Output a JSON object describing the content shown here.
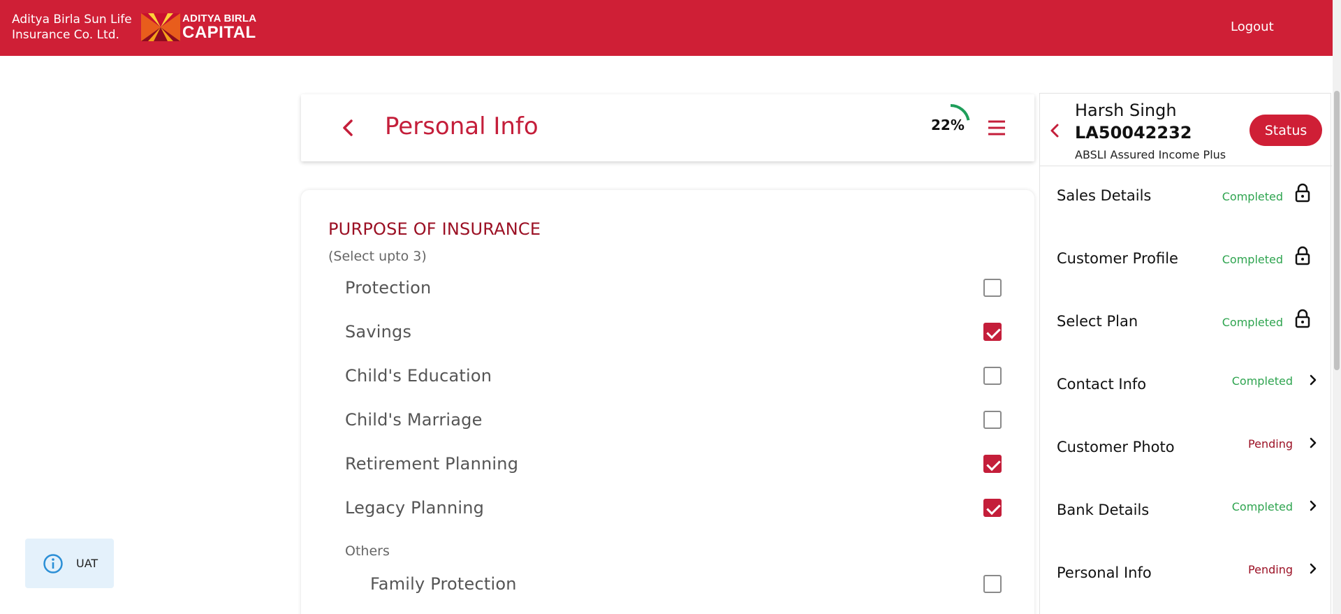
{
  "header": {
    "brand_line1": "Aditya Birla Sun Life",
    "brand_line2": "Insurance Co. Ltd.",
    "logo_line1": "ADITYA BIRLA",
    "logo_line2": "CAPITAL",
    "logout_label": "Logout",
    "bg_color": "#cf1f36"
  },
  "page": {
    "title": "Personal Info",
    "progress_text": "22%",
    "progress_value": 0.22
  },
  "purpose": {
    "title": "PURPOSE OF INSURANCE",
    "subtitle": "(Select upto 3)",
    "options": [
      {
        "label": "Protection",
        "checked": false
      },
      {
        "label": "Savings",
        "checked": true
      },
      {
        "label": "Child's Education",
        "checked": false
      },
      {
        "label": "Child's Marriage",
        "checked": false
      },
      {
        "label": "Retirement Planning",
        "checked": true
      },
      {
        "label": "Legacy Planning",
        "checked": true
      }
    ],
    "others_label": "Others",
    "other_options": [
      {
        "label": "Family Protection",
        "checked": false
      }
    ]
  },
  "env_badge": {
    "label": "UAT",
    "icon": "info-icon"
  },
  "side": {
    "customer_name": "Harsh Singh",
    "application_id": "LA50042232",
    "plan_name": "ABSLI Assured Income Plus",
    "status_label": "Status",
    "steps": [
      {
        "label": "Sales Details",
        "status": "Completed",
        "icon": "lock-icon"
      },
      {
        "label": "Customer Profile",
        "status": "Completed",
        "icon": "lock-icon"
      },
      {
        "label": "Select Plan",
        "status": "Completed",
        "icon": "lock-icon"
      },
      {
        "label": "Contact Info",
        "status": "Completed",
        "icon": "chevron-right-icon"
      },
      {
        "label": "Customer Photo",
        "status": "Pending",
        "icon": "chevron-right-icon"
      },
      {
        "label": "Bank Details",
        "status": "Completed",
        "icon": "chevron-right-icon"
      },
      {
        "label": "Personal Info",
        "status": "Pending",
        "icon": "chevron-right-icon"
      }
    ]
  }
}
